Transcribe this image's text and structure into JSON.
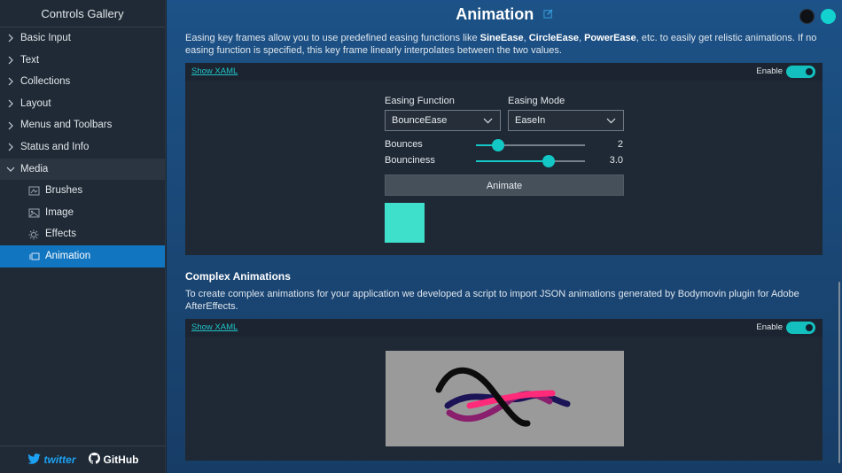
{
  "sidebar": {
    "title": "Controls Gallery",
    "items": [
      {
        "label": "Basic Input"
      },
      {
        "label": "Text"
      },
      {
        "label": "Collections"
      },
      {
        "label": "Layout"
      },
      {
        "label": "Menus and Toolbars"
      },
      {
        "label": "Status and Info"
      },
      {
        "label": "Media"
      }
    ],
    "sub_items": [
      {
        "label": "Brushes",
        "icon": "brushes-icon"
      },
      {
        "label": "Image",
        "icon": "image-icon"
      },
      {
        "label": "Effects",
        "icon": "effects-icon"
      },
      {
        "label": "Animation",
        "icon": "animation-icon"
      }
    ],
    "footer": {
      "twitter": "twitter",
      "github": "GitHub"
    }
  },
  "header": {
    "title": "Animation"
  },
  "colors": {
    "accent": "#13c8c6",
    "selected": "#1275c0",
    "square": "#3ee0cc"
  },
  "intro": {
    "text_1": "Easing key frames allow you to use predefined easing functions like ",
    "bold_1": "SineEase",
    "sep_1": ", ",
    "bold_2": "CircleEase",
    "sep_2": ", ",
    "bold_3": "PowerEase",
    "text_2": ", etc. to easily get relistic animations. If no easing function is specified, this key frame linearly interpolates between the two values."
  },
  "card1": {
    "show_xaml": "Show XAML",
    "enable": "Enable",
    "easing_function_label": "Easing Function",
    "easing_function_value": "BounceEase",
    "easing_mode_label": "Easing Mode",
    "easing_mode_value": "EaseIn",
    "bounces_label": "Bounces",
    "bounces_value": "2",
    "bounces_fraction": 0.2,
    "bounciness_label": "Bounciness",
    "bounciness_value": "3.0",
    "bounciness_fraction": 0.67,
    "animate_label": "Animate"
  },
  "complex": {
    "title": "Complex Animations",
    "text": "To create complex animations for your application we developed a script to import JSON animations generated by Bodymovin plugin for Adobe AfterEffects."
  },
  "card2": {
    "show_xaml": "Show XAML",
    "enable": "Enable"
  }
}
